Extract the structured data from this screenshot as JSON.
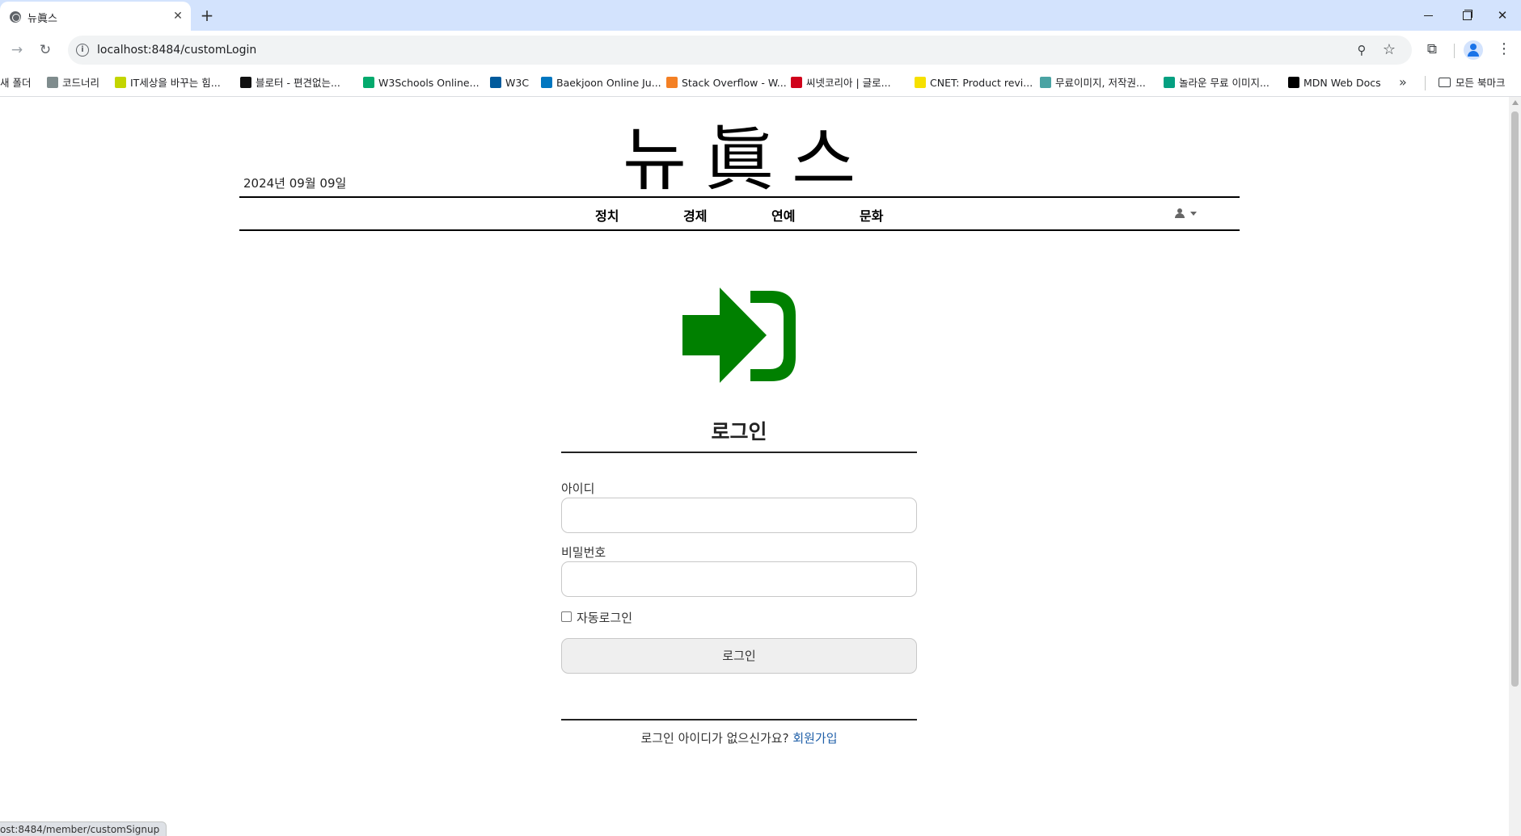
{
  "browser": {
    "tab_title": "뉴眞스",
    "tab_close": "✕",
    "new_tab": "+",
    "url": "localhost:8484/customLogin",
    "bookmarks": [
      {
        "label": "새 폴더",
        "icon": "folder-icon",
        "color": "#5f6368"
      },
      {
        "label": "코드너리",
        "icon": "code-icon",
        "color": "#7f8c8d"
      },
      {
        "label": "IT세상을 바꾸는 힘...",
        "icon": "it-icon",
        "color": "#c3d500"
      },
      {
        "label": "블로터 - 편견없는...",
        "icon": "bloter-icon",
        "color": "#111111"
      },
      {
        "label": "W3Schools Online...",
        "icon": "w3schools-icon",
        "color": "#04aa6d"
      },
      {
        "label": "W3C",
        "icon": "w3c-icon",
        "color": "#005a9c"
      },
      {
        "label": "Baekjoon Online Ju...",
        "icon": "baekjoon-icon",
        "color": "#0076c0"
      },
      {
        "label": "Stack Overflow - W...",
        "icon": "stackoverflow-icon",
        "color": "#f48024"
      },
      {
        "label": "씨넷코리아 | 글로...",
        "icon": "cnet-korea-icon",
        "color": "#d0021b"
      },
      {
        "label": "CNET: Product revi...",
        "icon": "cnet-icon",
        "color": "#f6e000"
      },
      {
        "label": "무료이미지, 저작권...",
        "icon": "image-site-icon",
        "color": "#4aa3a3"
      },
      {
        "label": "놀라운 무료 이미지...",
        "icon": "pexels-icon",
        "color": "#05a081"
      },
      {
        "label": "MDN Web Docs",
        "icon": "mdn-icon",
        "color": "#000000"
      }
    ],
    "more_bookmarks": "»",
    "all_bookmarks": "모든 북마크",
    "status_url": "ost:8484/member/customSignup"
  },
  "header": {
    "logo": "뉴眞스",
    "date": "2024년 09월 09일",
    "nav": [
      "정치",
      "경제",
      "연예",
      "문화"
    ]
  },
  "login": {
    "icon": "sign-in-icon",
    "icon_color": "#008000",
    "title": "로그인",
    "id_label": "아이디",
    "id_value": "",
    "pw_label": "비밀번호",
    "pw_value": "",
    "remember_label": "자동로그인",
    "remember_checked": false,
    "submit_label": "로그인",
    "signup_prompt": "로그인 아이디가 없으신가요? ",
    "signup_link": "회원가입"
  }
}
